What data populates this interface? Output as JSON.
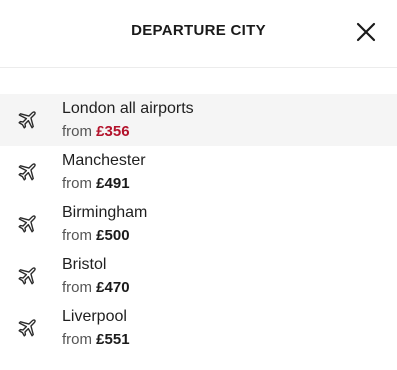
{
  "header": {
    "title": "DEPARTURE CITY",
    "close_icon": "close-icon"
  },
  "colors": {
    "highlight_price": "#b3122b",
    "selected_row_bg": "#f5f5f5"
  },
  "cities": [
    {
      "name": "London all airports",
      "from_label": "from",
      "price": "£356",
      "icon": "airplane-icon",
      "selected": true
    },
    {
      "name": "Manchester",
      "from_label": "from",
      "price": "£491",
      "icon": "airplane-icon",
      "selected": false
    },
    {
      "name": "Birmingham",
      "from_label": "from",
      "price": "£500",
      "icon": "airplane-icon",
      "selected": false
    },
    {
      "name": "Bristol",
      "from_label": "from",
      "price": "£470",
      "icon": "airplane-icon",
      "selected": false
    },
    {
      "name": "Liverpool",
      "from_label": "from",
      "price": "£551",
      "icon": "airplane-icon",
      "selected": false
    }
  ]
}
